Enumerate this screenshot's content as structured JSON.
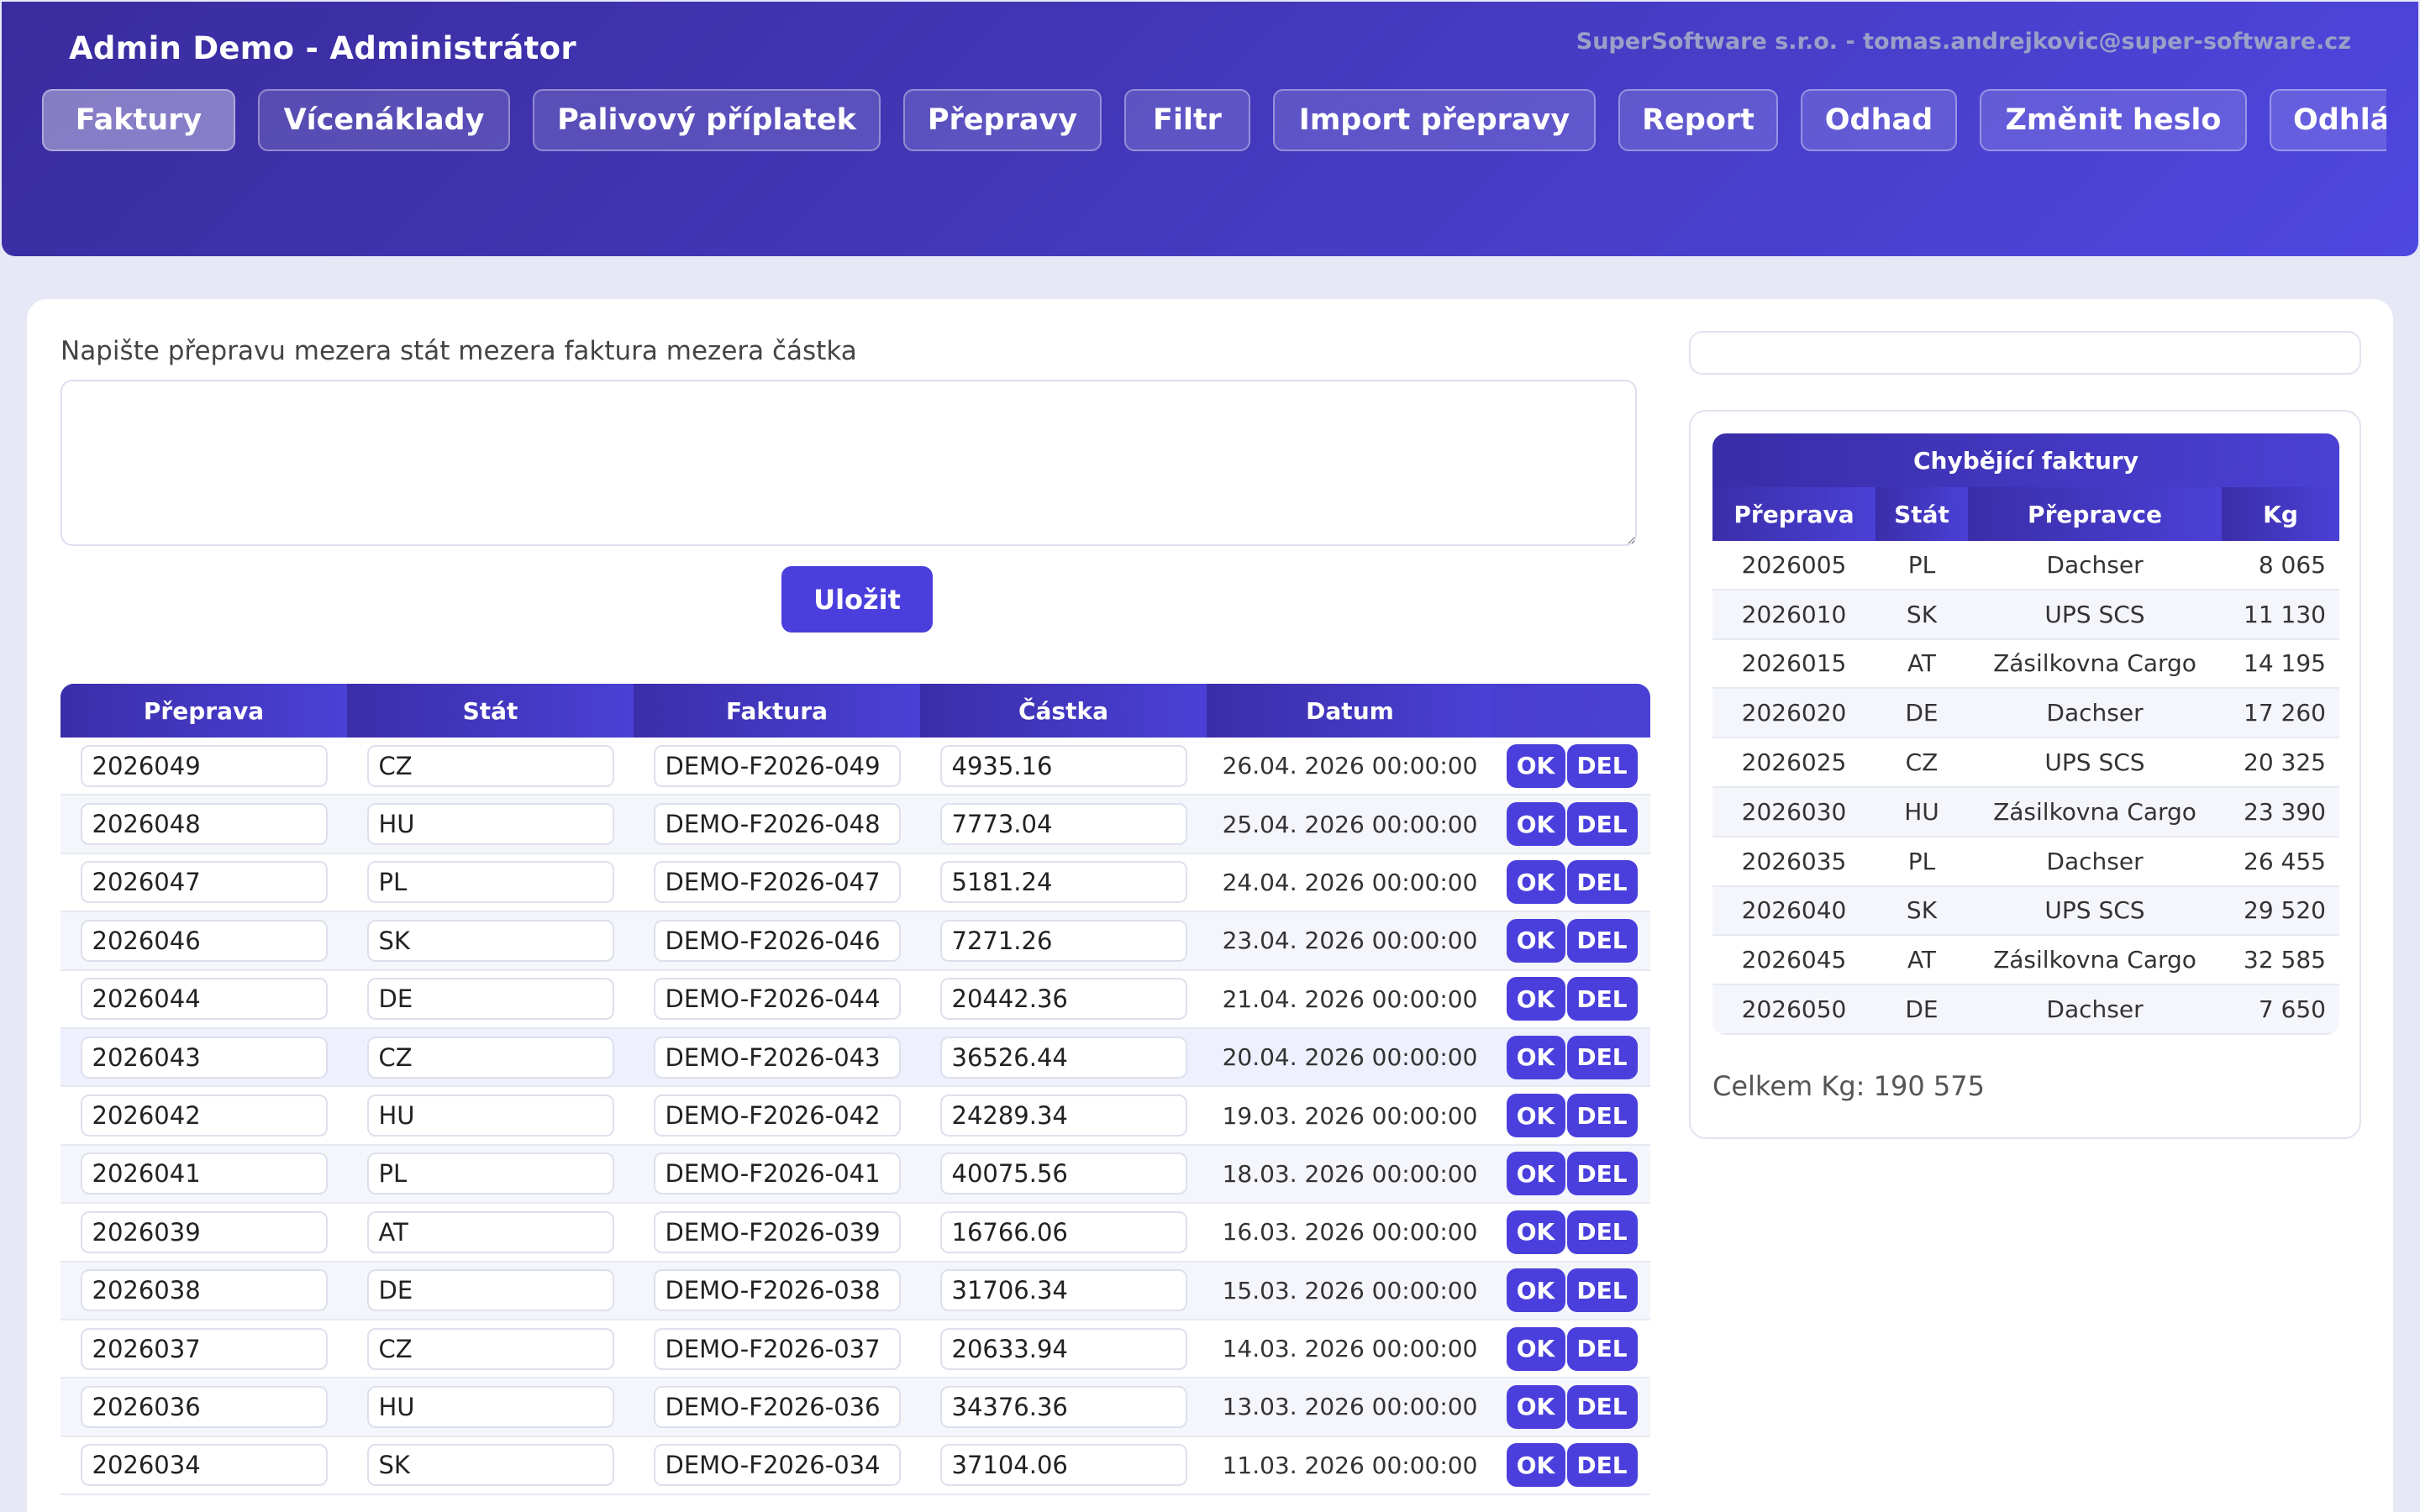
{
  "header": {
    "title": "Admin Demo - Administrátor",
    "company": "SuperSoftware s.r.o. - tomas.andrejkovic@super-software.cz",
    "nav": [
      {
        "label": "Faktury",
        "active": true
      },
      {
        "label": "Vícenáklady",
        "active": false
      },
      {
        "label": "Palivový příplatek",
        "active": false
      },
      {
        "label": "Přepravy",
        "active": false
      },
      {
        "label": "Filtr",
        "active": false
      },
      {
        "label": "Import přepravy",
        "active": false
      },
      {
        "label": "Report",
        "active": false
      },
      {
        "label": "Odhad",
        "active": false
      },
      {
        "label": "Změnit heslo",
        "active": false
      },
      {
        "label": "Odhlásit",
        "active": false
      }
    ]
  },
  "form": {
    "label": "Napište přepravu mezera stát mezera faktura mezera částka",
    "value": "",
    "save_label": "Uložit"
  },
  "invoices": {
    "columns": [
      "Přeprava",
      "Stát",
      "Faktura",
      "Částka",
      "Datum",
      ""
    ],
    "ok_label": "OK",
    "del_label": "DEL",
    "rows": [
      {
        "preprava": "2026049",
        "stat": "CZ",
        "faktura": "DEMO-F2026-049",
        "castka": "4935.16",
        "datum": "26.04. 2026 00:00:00"
      },
      {
        "preprava": "2026048",
        "stat": "HU",
        "faktura": "DEMO-F2026-048",
        "castka": "7773.04",
        "datum": "25.04. 2026 00:00:00"
      },
      {
        "preprava": "2026047",
        "stat": "PL",
        "faktura": "DEMO-F2026-047",
        "castka": "5181.24",
        "datum": "24.04. 2026 00:00:00"
      },
      {
        "preprava": "2026046",
        "stat": "SK",
        "faktura": "DEMO-F2026-046",
        "castka": "7271.26",
        "datum": "23.04. 2026 00:00:00"
      },
      {
        "preprava": "2026044",
        "stat": "DE",
        "faktura": "DEMO-F2026-044",
        "castka": "20442.36",
        "datum": "21.04. 2026 00:00:00"
      },
      {
        "preprava": "2026043",
        "stat": "CZ",
        "faktura": "DEMO-F2026-043",
        "castka": "36526.44",
        "datum": "20.04. 2026 00:00:00"
      },
      {
        "preprava": "2026042",
        "stat": "HU",
        "faktura": "DEMO-F2026-042",
        "castka": "24289.34",
        "datum": "19.03. 2026 00:00:00"
      },
      {
        "preprava": "2026041",
        "stat": "PL",
        "faktura": "DEMO-F2026-041",
        "castka": "40075.56",
        "datum": "18.03. 2026 00:00:00"
      },
      {
        "preprava": "2026039",
        "stat": "AT",
        "faktura": "DEMO-F2026-039",
        "castka": "16766.06",
        "datum": "16.03. 2026 00:00:00"
      },
      {
        "preprava": "2026038",
        "stat": "DE",
        "faktura": "DEMO-F2026-038",
        "castka": "31706.34",
        "datum": "15.03. 2026 00:00:00"
      },
      {
        "preprava": "2026037",
        "stat": "CZ",
        "faktura": "DEMO-F2026-037",
        "castka": "20633.94",
        "datum": "14.03. 2026 00:00:00"
      },
      {
        "preprava": "2026036",
        "stat": "HU",
        "faktura": "DEMO-F2026-036",
        "castka": "34376.36",
        "datum": "13.03. 2026 00:00:00"
      },
      {
        "preprava": "2026034",
        "stat": "SK",
        "faktura": "DEMO-F2026-034",
        "castka": "37104.06",
        "datum": "11.03. 2026 00:00:00"
      }
    ]
  },
  "missing": {
    "title": "Chybějící faktury",
    "columns": [
      "Přeprava",
      "Stát",
      "Přepravce",
      "Kg"
    ],
    "rows": [
      {
        "preprava": "2026005",
        "stat": "PL",
        "prepravce": "Dachser",
        "kg": "8 065"
      },
      {
        "preprava": "2026010",
        "stat": "SK",
        "prepravce": "UPS SCS",
        "kg": "11 130"
      },
      {
        "preprava": "2026015",
        "stat": "AT",
        "prepravce": "Zásilkovna Cargo",
        "kg": "14 195"
      },
      {
        "preprava": "2026020",
        "stat": "DE",
        "prepravce": "Dachser",
        "kg": "17 260"
      },
      {
        "preprava": "2026025",
        "stat": "CZ",
        "prepravce": "UPS SCS",
        "kg": "20 325"
      },
      {
        "preprava": "2026030",
        "stat": "HU",
        "prepravce": "Zásilkovna Cargo",
        "kg": "23 390"
      },
      {
        "preprava": "2026035",
        "stat": "PL",
        "prepravce": "Dachser",
        "kg": "26 455"
      },
      {
        "preprava": "2026040",
        "stat": "SK",
        "prepravce": "UPS SCS",
        "kg": "29 520"
      },
      {
        "preprava": "2026045",
        "stat": "AT",
        "prepravce": "Zásilkovna Cargo",
        "kg": "32 585"
      },
      {
        "preprava": "2026050",
        "stat": "DE",
        "prepravce": "Dachser",
        "kg": "7 650"
      }
    ],
    "total": "Celkem Kg: 190 575"
  }
}
